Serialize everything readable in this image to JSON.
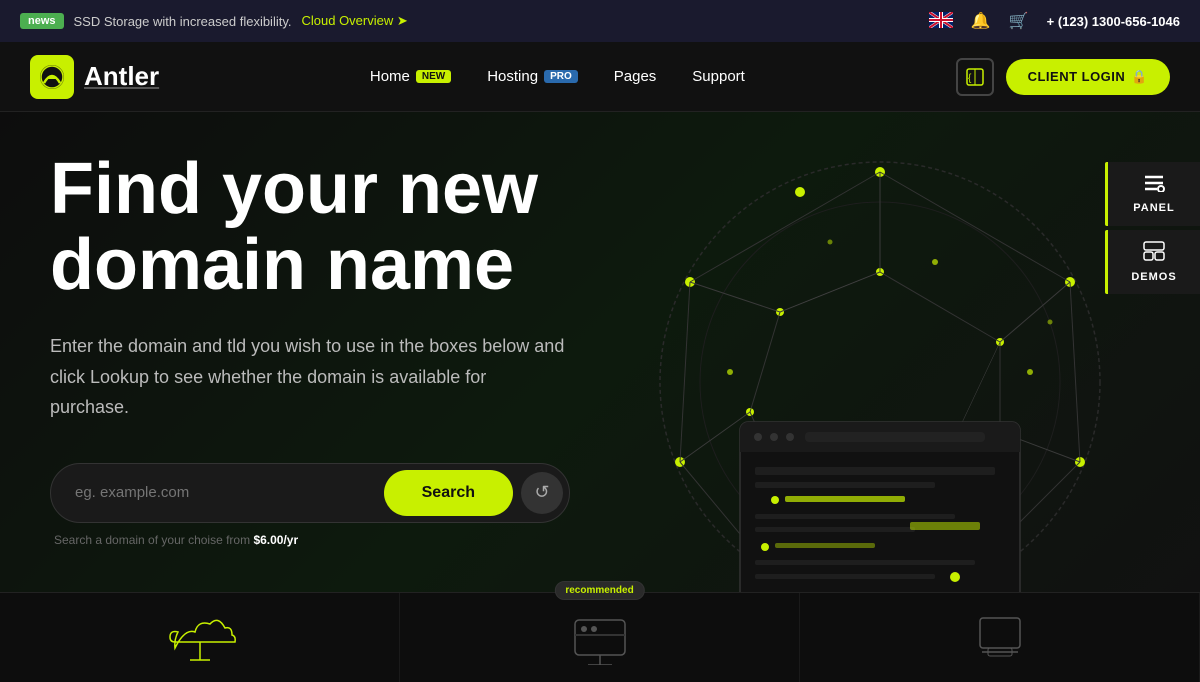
{
  "topbar": {
    "news_badge": "news",
    "announcement": "SSD Storage with increased flexibility.",
    "cloud_link": "Cloud Overview",
    "arrow": "➤",
    "phone": "+ (123) 1300-656-1046"
  },
  "navbar": {
    "logo_text": "Antler",
    "logo_symbol": "≋",
    "nav_items": [
      {
        "label": "Home",
        "badge": "NEW",
        "badge_type": "new"
      },
      {
        "label": "Hosting",
        "badge": "PRO",
        "badge_type": "pro"
      },
      {
        "label": "Pages",
        "badge": "",
        "badge_type": ""
      },
      {
        "label": "Support",
        "badge": "",
        "badge_type": ""
      }
    ],
    "panel_icon": "{<}",
    "client_login": "CLIENT LOGIN",
    "lock_icon": "🔒"
  },
  "hero": {
    "title_line1": "Find your new",
    "title_line2": "domain name",
    "description": "Enter the domain and tld you wish to use in the boxes below and click Lookup to see whether the domain is available for purchase.",
    "search_placeholder": "eg. example.com",
    "search_button": "Search",
    "hint_prefix": "Search a domain of your choise from ",
    "hint_price": "$6.00/yr"
  },
  "panel_widgets": [
    {
      "icon": "≡",
      "label": "PANEL"
    },
    {
      "icon": "◧",
      "label": "DEMOS"
    }
  ],
  "cards": [
    {
      "recommended": false
    },
    {
      "recommended": true,
      "badge": "recommended"
    },
    {
      "recommended": false
    }
  ],
  "icons": {
    "bell": "🔔",
    "cart": "🛒",
    "refresh": "↺",
    "lock": "🔒"
  }
}
